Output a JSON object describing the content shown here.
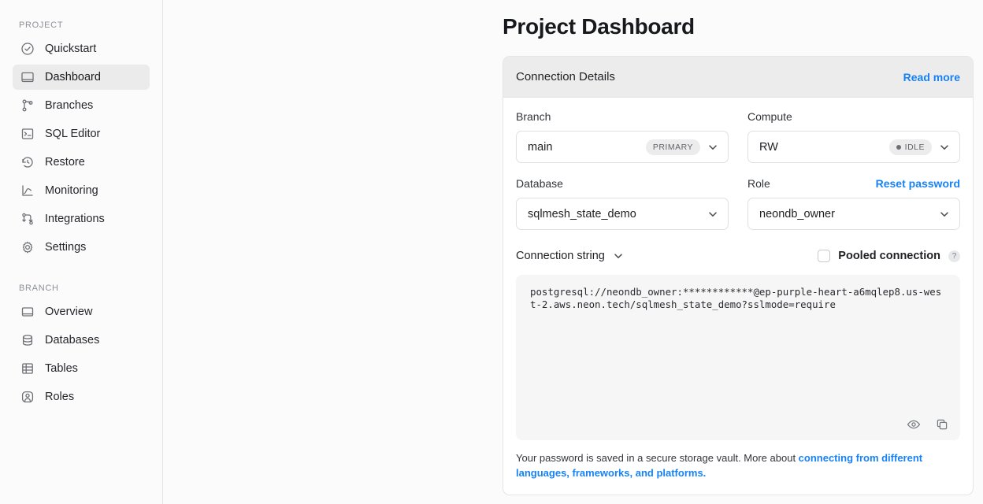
{
  "sidebar": {
    "project_section_label": "PROJECT",
    "project_items": [
      {
        "label": "Quickstart",
        "icon": "check-circle-icon",
        "active": false
      },
      {
        "label": "Dashboard",
        "icon": "dashboard-icon",
        "active": true
      },
      {
        "label": "Branches",
        "icon": "branches-icon",
        "active": false
      },
      {
        "label": "SQL Editor",
        "icon": "sql-editor-icon",
        "active": false
      },
      {
        "label": "Restore",
        "icon": "restore-clock-icon",
        "active": false
      },
      {
        "label": "Monitoring",
        "icon": "monitoring-chart-icon",
        "active": false
      },
      {
        "label": "Integrations",
        "icon": "integrations-icon",
        "active": false
      },
      {
        "label": "Settings",
        "icon": "gear-icon",
        "active": false
      }
    ],
    "branch_section_label": "BRANCH",
    "branch_items": [
      {
        "label": "Overview",
        "icon": "overview-icon",
        "active": false
      },
      {
        "label": "Databases",
        "icon": "database-icon",
        "active": false
      },
      {
        "label": "Tables",
        "icon": "table-icon",
        "active": false
      },
      {
        "label": "Roles",
        "icon": "roles-user-icon",
        "active": false
      }
    ]
  },
  "page": {
    "title": "Project Dashboard"
  },
  "card": {
    "header_title": "Connection Details",
    "read_more_label": "Read more",
    "branch": {
      "label": "Branch",
      "value": "main",
      "badge": "PRIMARY"
    },
    "compute": {
      "label": "Compute",
      "value": "RW",
      "badge": "IDLE",
      "badge_dot_color": "#6c6f75"
    },
    "database": {
      "label": "Database",
      "value": "sqlmesh_state_demo"
    },
    "role": {
      "label": "Role",
      "value": "neondb_owner",
      "reset_password_label": "Reset password"
    },
    "connection_string": {
      "label": "Connection string",
      "pooled_label": "Pooled connection",
      "pooled_checked": false,
      "help_glyph": "?",
      "value": "postgresql://neondb_owner:************@ep-purple-heart-a6mqlep8.us-west-2.aws.neon.tech/sqlmesh_state_demo?sslmode=require"
    },
    "footnote": {
      "text": "Your password is saved in a secure storage vault. More about ",
      "link": "connecting from different languages, frameworks, and platforms."
    }
  },
  "colors": {
    "accent_link": "#1682f5",
    "page_bg": "#fbfbfb",
    "card_header_bg": "#ececed",
    "code_bg": "#f6f6f7"
  }
}
